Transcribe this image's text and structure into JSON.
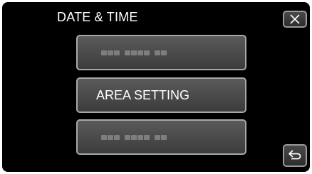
{
  "header": {
    "title": "DATE & TIME"
  },
  "menu": {
    "items": [
      {
        "label": "",
        "placeholder": true
      },
      {
        "label": "AREA SETTING",
        "placeholder": false
      },
      {
        "label": "",
        "placeholder": true
      }
    ]
  },
  "icons": {
    "close": "close-icon",
    "back": "back-arrow-icon"
  },
  "colors": {
    "background": "#000000",
    "button_border": "#a8a8a8",
    "button_fill": "#4a4a4a",
    "placeholder_dots": "#7e7e7e",
    "text": "#ffffff"
  }
}
